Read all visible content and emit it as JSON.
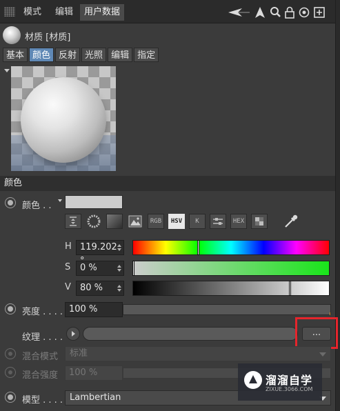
{
  "menubar": {
    "items": [
      {
        "label": "模式",
        "active": false
      },
      {
        "label": "编辑",
        "active": false
      },
      {
        "label": "用户数据",
        "active": true
      }
    ],
    "icons": [
      "back-arrow-icon",
      "cursor-arrow-icon",
      "search-icon",
      "lock-icon",
      "target-icon",
      "add-icon"
    ]
  },
  "material": {
    "title": "材质 [材质]"
  },
  "tabs": [
    {
      "label": "基本",
      "active": false
    },
    {
      "label": "颜色",
      "active": true
    },
    {
      "label": "反射",
      "active": false
    },
    {
      "label": "光照",
      "active": false
    },
    {
      "label": "编辑",
      "active": false
    },
    {
      "label": "指定",
      "active": false
    }
  ],
  "section": {
    "title": "颜色"
  },
  "color": {
    "label": "颜色 . .",
    "swatch": "#cccccc",
    "picker_buttons": [
      {
        "name": "spectrum-icon",
        "text": "",
        "active": false
      },
      {
        "name": "color-wheel-icon",
        "text": "",
        "active": false
      },
      {
        "name": "gradient-square-icon",
        "text": "",
        "active": false
      },
      {
        "name": "image-icon",
        "text": "",
        "active": false
      },
      {
        "name": "rgb-button",
        "text": "RGB",
        "active": false
      },
      {
        "name": "hsv-button",
        "text": "HSV",
        "active": true
      },
      {
        "name": "kelvin-button",
        "text": "K",
        "active": false
      },
      {
        "name": "mixer-icon",
        "text": "",
        "active": false
      },
      {
        "name": "hex-button",
        "text": "HEX",
        "active": false
      },
      {
        "name": "swatches-icon",
        "text": "",
        "active": false
      },
      {
        "name": "eyedropper-icon",
        "text": "",
        "active": false
      }
    ],
    "h": {
      "letter": "H",
      "value": "119.202 °",
      "fraction": 0.331
    },
    "s": {
      "letter": "S",
      "value": "0 %",
      "fraction": 0.0
    },
    "v": {
      "letter": "V",
      "value": "80 %",
      "fraction": 0.8
    }
  },
  "brightness": {
    "label": "亮度 . . . .",
    "value": "100 %",
    "fraction": 1.0
  },
  "texture": {
    "label": "纹理 . . . .",
    "button": "..."
  },
  "blend_mode": {
    "label": "混合模式",
    "value": "标准"
  },
  "blend_strength": {
    "label": "混合强度",
    "value": "100 %"
  },
  "model": {
    "label": "模型 . . . .",
    "value": "Lambertian"
  },
  "watermark": {
    "title": "溜溜自学",
    "url": "ZIXUE.3066.COM"
  },
  "colors": {
    "accent_tab": "#5f88b5",
    "highlight": "#e5252c"
  }
}
